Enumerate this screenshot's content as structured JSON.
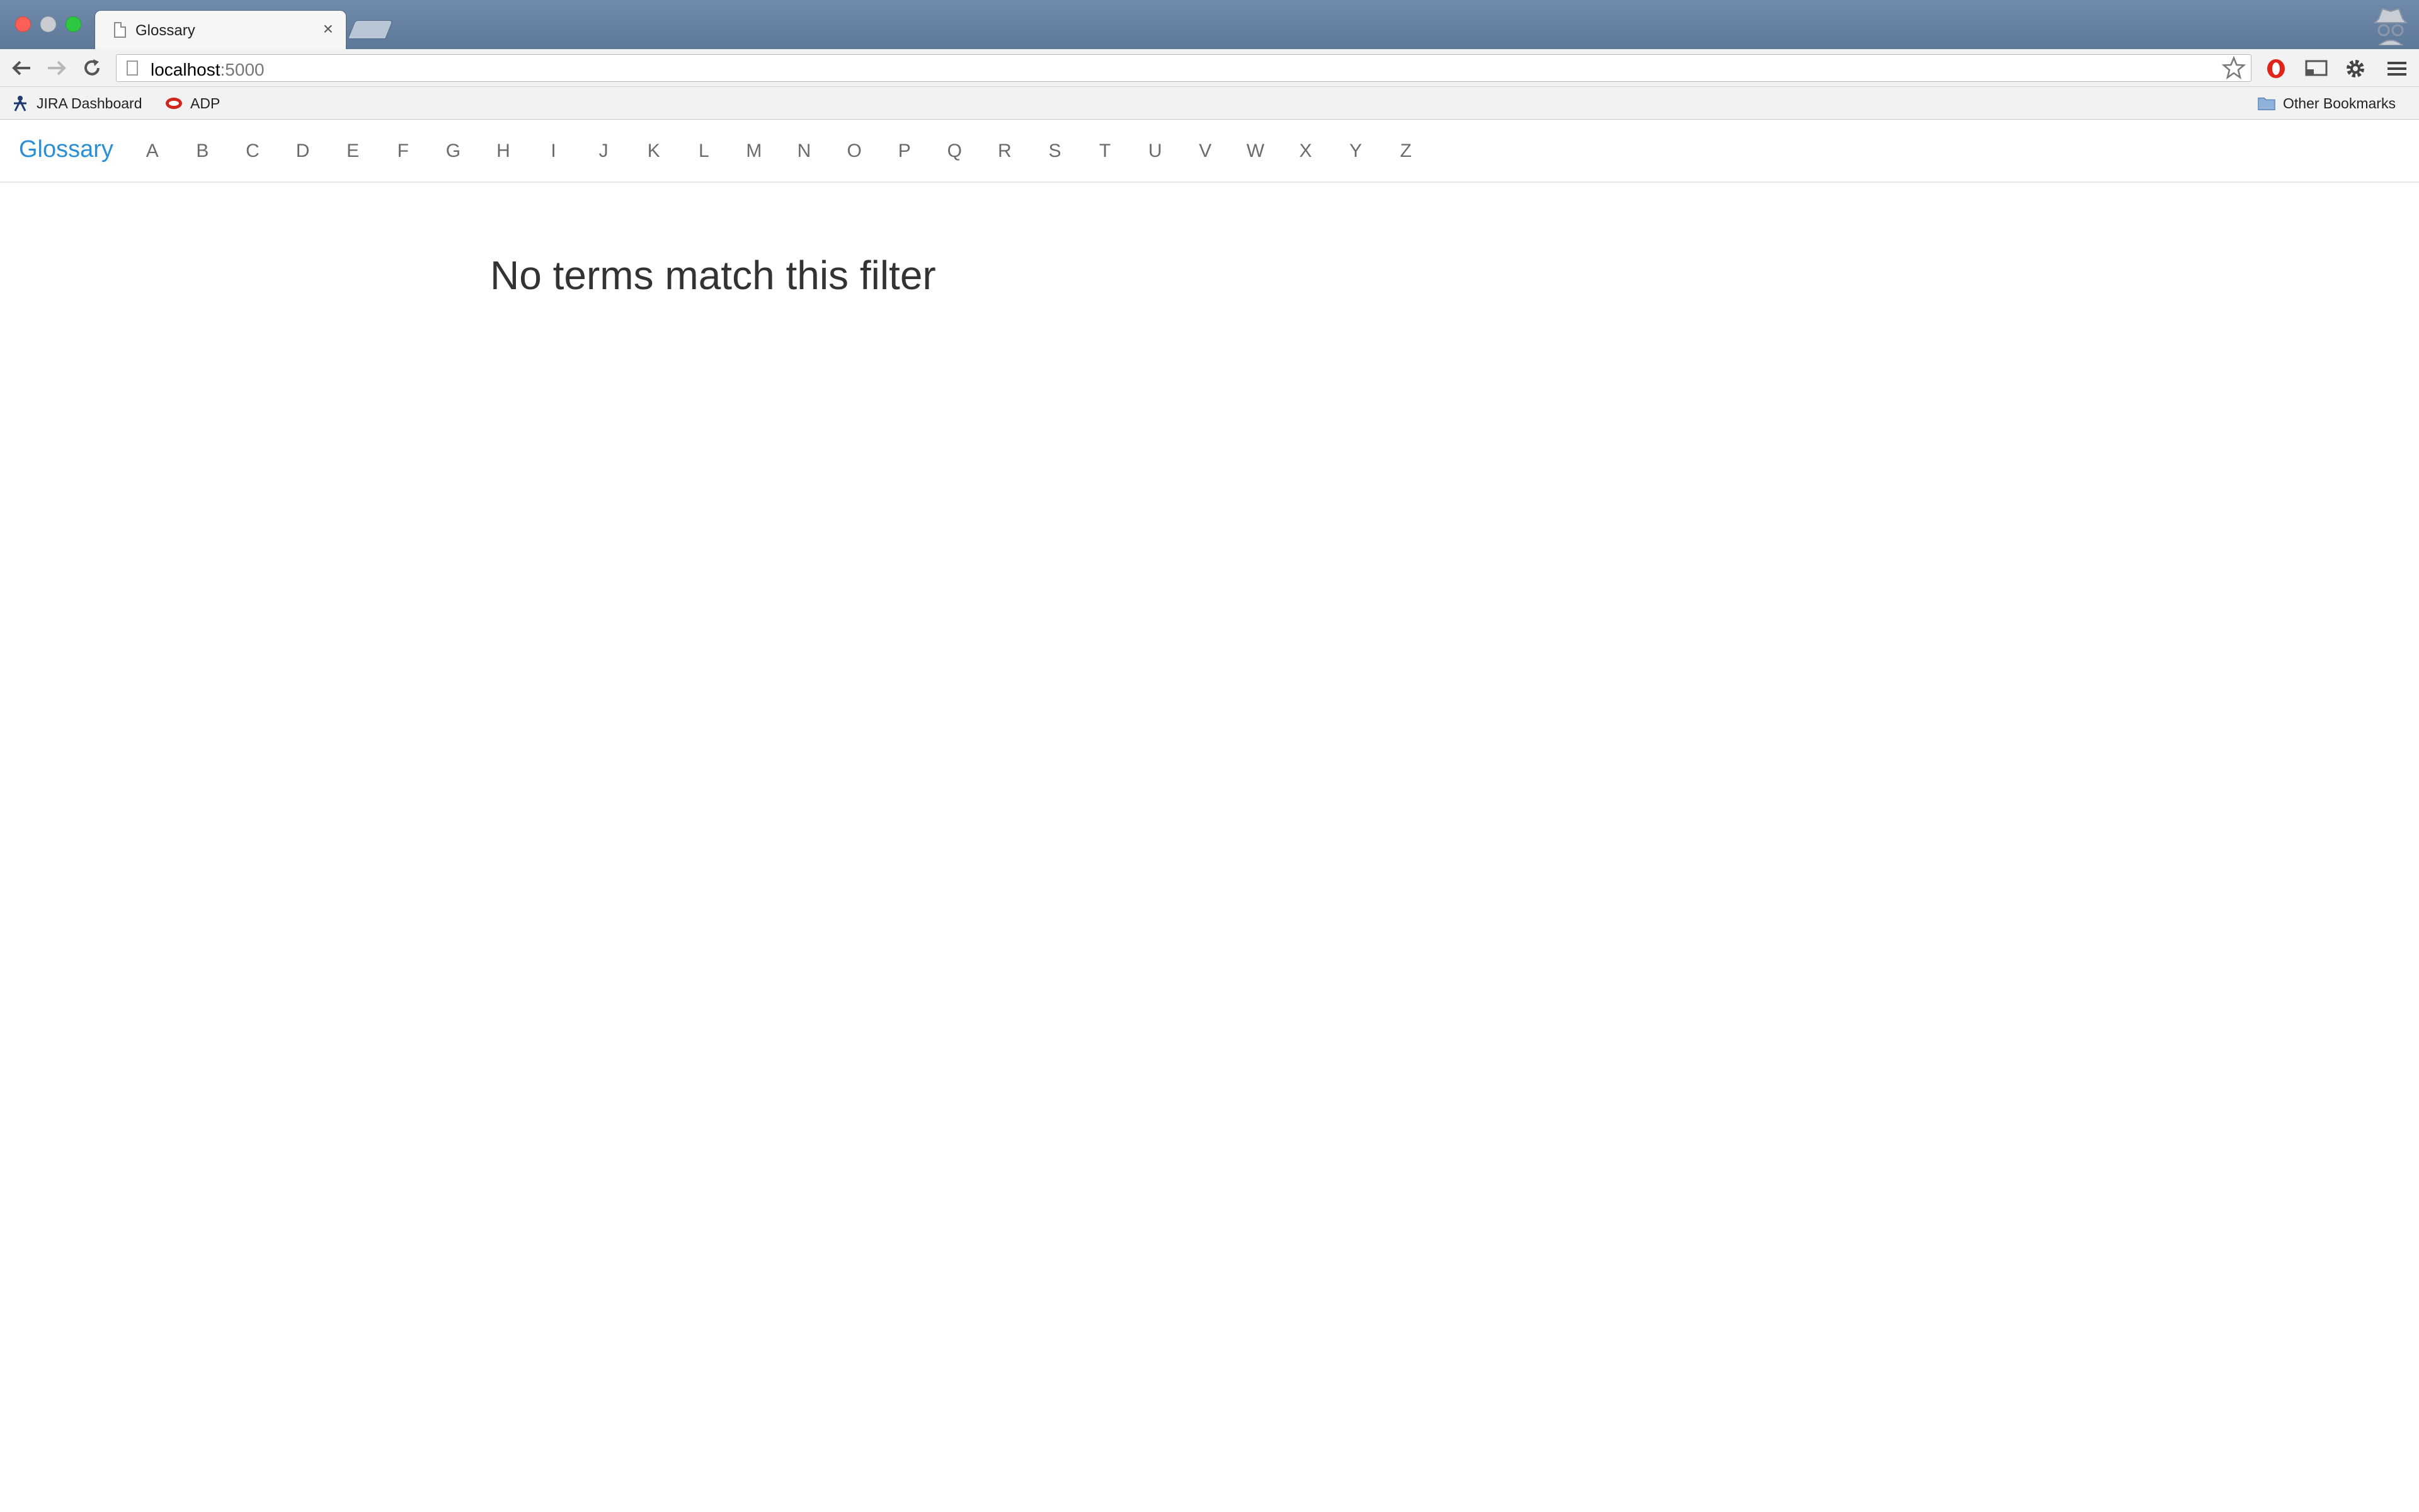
{
  "browser": {
    "tab_title": "Glossary",
    "url_host": "localhost",
    "url_port": ":5000",
    "bookmarks": [
      {
        "label": "JIRA Dashboard"
      },
      {
        "label": "ADP"
      }
    ],
    "other_bookmarks": "Other Bookmarks"
  },
  "navbar": {
    "brand": "Glossary",
    "letters": [
      "A",
      "B",
      "C",
      "D",
      "E",
      "F",
      "G",
      "H",
      "I",
      "J",
      "K",
      "L",
      "M",
      "N",
      "O",
      "P",
      "Q",
      "R",
      "S",
      "T",
      "U",
      "V",
      "W",
      "X",
      "Y",
      "Z"
    ]
  },
  "main": {
    "empty_message": "No terms match this filter"
  },
  "colors": {
    "brand": "#2b8fd6",
    "letter": "#6b6b6b",
    "heading": "#333333"
  }
}
